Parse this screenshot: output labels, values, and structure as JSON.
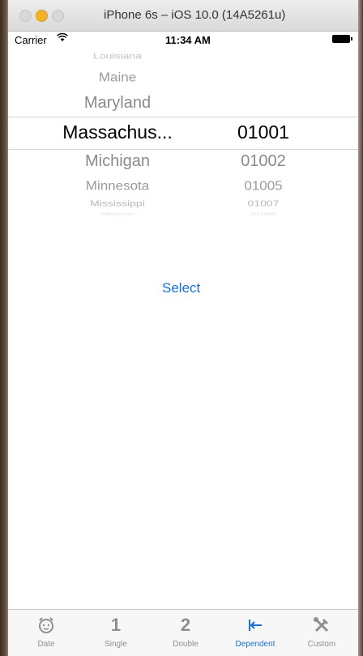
{
  "window": {
    "title": "iPhone 6s – iOS 10.0 (14A5261u)"
  },
  "status_bar": {
    "carrier": "Carrier",
    "time": "11:34 AM"
  },
  "picker": {
    "states": [
      "Louisiana",
      "Maine",
      "Maryland",
      "Massachus...",
      "Michigan",
      "Minnesota",
      "Mississippi",
      "Missouri"
    ],
    "zips": [
      "",
      "",
      "",
      "01001",
      "01002",
      "01005",
      "01007",
      "01008"
    ],
    "selected_state": "Massachus...",
    "selected_zip": "01001"
  },
  "select_button": {
    "label": "Select"
  },
  "accent_color": "#1a6fd6",
  "tab_bar": {
    "tabs": [
      {
        "label": "Date",
        "icon": "alarm-clock-icon"
      },
      {
        "label": "Single",
        "icon": "1"
      },
      {
        "label": "Double",
        "icon": "2"
      },
      {
        "label": "Dependent",
        "icon": "arrow-to-left-icon"
      },
      {
        "label": "Custom",
        "icon": "tools-icon"
      }
    ],
    "active": "Dependent"
  }
}
